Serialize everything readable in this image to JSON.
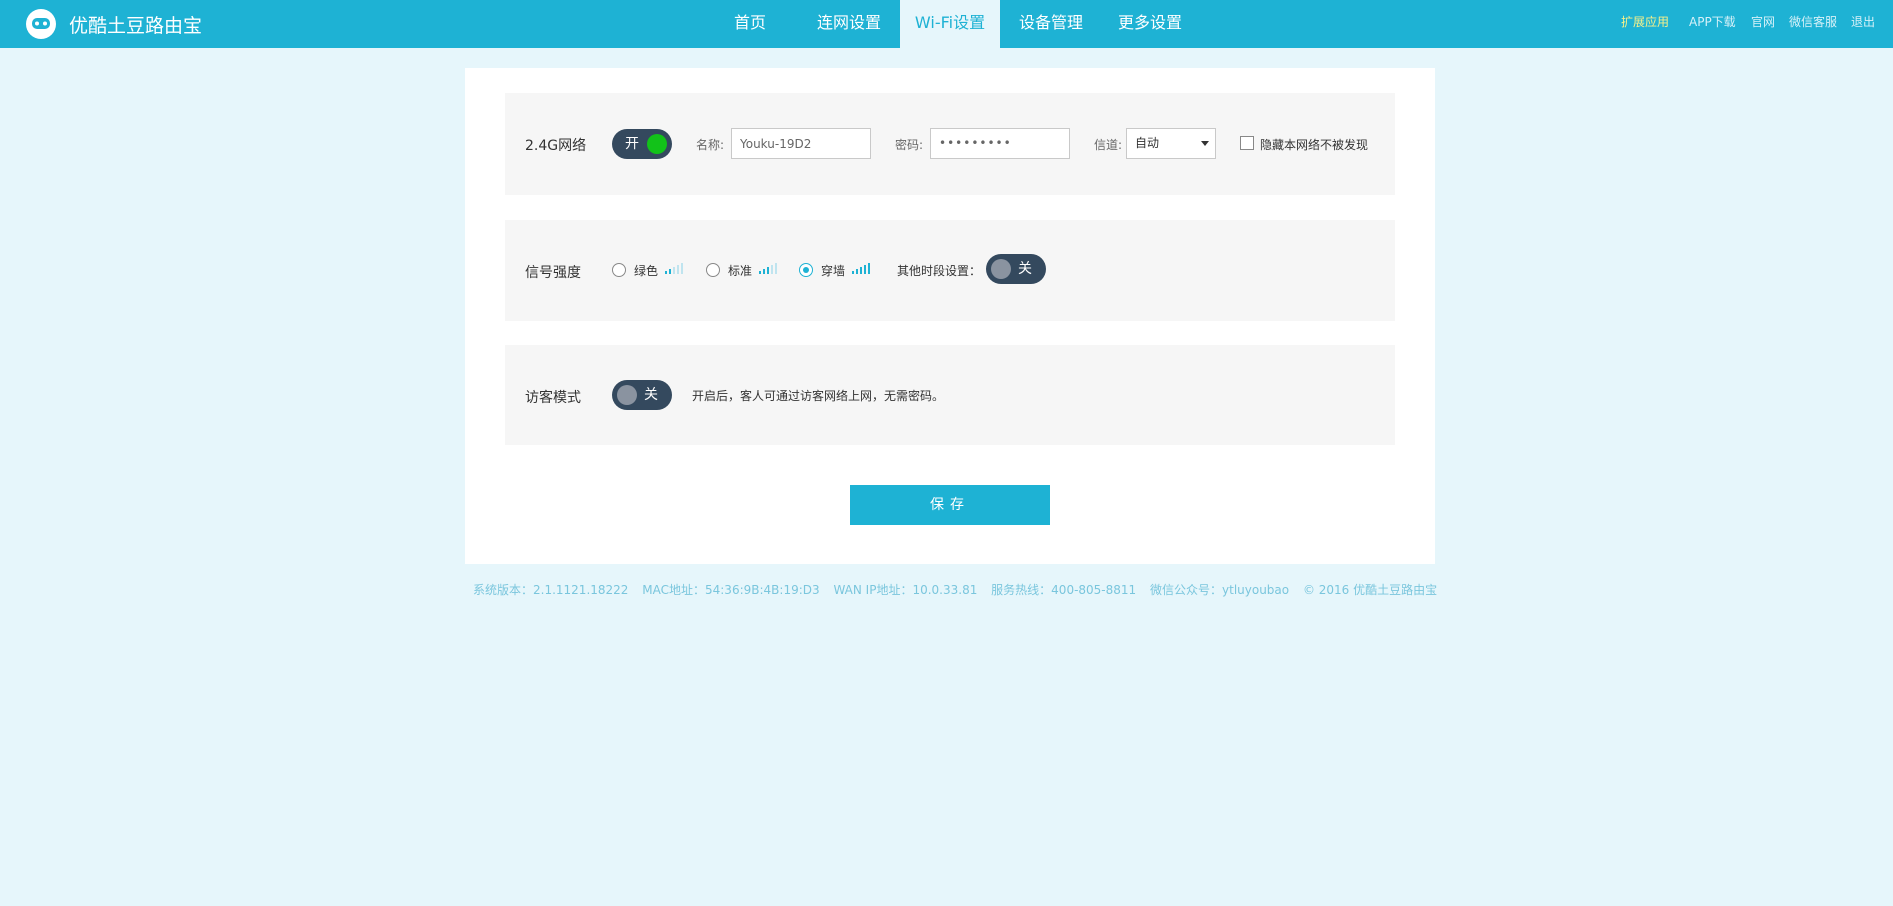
{
  "header": {
    "brand": "优酷土豆路由宝",
    "nav": [
      "首页",
      "连网设置",
      "Wi-Fi设置",
      "设备管理",
      "更多设置"
    ],
    "active_nav": "Wi-Fi设置",
    "links": [
      "扩展应用",
      "APP下载",
      "官网",
      "微信客服",
      "退出"
    ]
  },
  "network": {
    "label": "2.4G网络",
    "toggle_text": "开",
    "name_label": "名称:",
    "name_value": "Youku-19D2",
    "password_label": "密码:",
    "password_value": "•••••••••",
    "channel_label": "信道:",
    "channel_value": "自动",
    "hide_label": "隐藏本网络不被发现",
    "hide_checked": false
  },
  "signal": {
    "label": "信号强度",
    "options": [
      "绿色",
      "标准",
      "穿墙"
    ],
    "selected": "穿墙",
    "schedule_label": "其他时段设置：",
    "schedule_toggle_text": "关"
  },
  "guest": {
    "label": "访客模式",
    "toggle_text": "关",
    "hint": "开启后，客人可通过访客网络上网，无需密码。"
  },
  "save_label": "保存",
  "footer": {
    "version": "系统版本：2.1.1121.18222",
    "mac": "MAC地址：54:36:9B:4B:19:D3",
    "wan": "WAN IP地址：10.0.33.81",
    "hotline": "服务热线：400-805-8811",
    "wechat": "微信公众号：ytluyoubao",
    "copyright": "© 2016 优酷土豆路由宝"
  },
  "colors": {
    "accent": "#1eb2d4",
    "background": "#e6f6fb",
    "toggle_dark": "#34495e",
    "toggle_on_knob": "#12c219"
  }
}
